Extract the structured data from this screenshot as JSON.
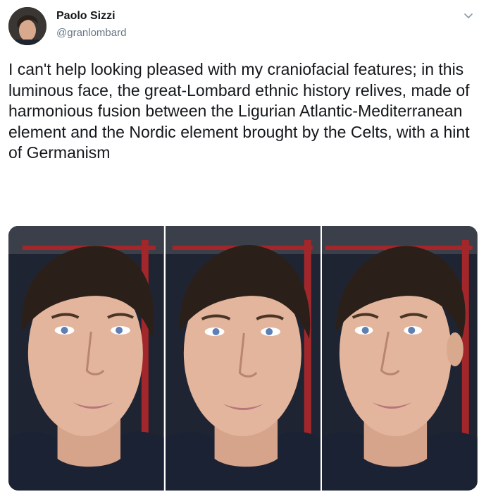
{
  "author": {
    "name": "Paolo Sizzi",
    "handle": "@granlombard"
  },
  "tweet": {
    "text": "I can't help looking pleased with my craniofacial features; in this luminous face, the great-Lombard ethnic history relives, made of harmonious fusion between the Ligurian Atlantic-Mediterranean element and the Nordic element brought by the Celts, with a hint of Germanism"
  },
  "icons": {
    "caret": "chevron-down-icon"
  },
  "media": {
    "photo_count": 3
  },
  "colors": {
    "text": "#14171a",
    "secondary": "#657786",
    "background": "#ffffff"
  }
}
